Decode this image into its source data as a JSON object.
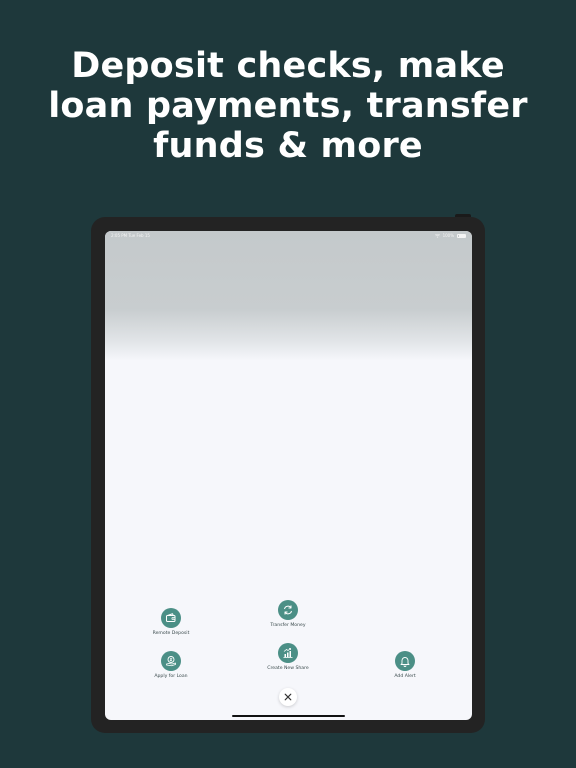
{
  "headline": {
    "line1": "Deposit checks, make",
    "line2": "loan payments, transfer",
    "line3": "funds & more"
  },
  "statusbar": {
    "time": "2:05 PM   Tue Feb 15",
    "battery": "100%"
  },
  "actions": {
    "remote_deposit": "Remote Deposit",
    "transfer_money": "Transfer Money",
    "apply_for_loan": "Apply for Loan",
    "create_new_share": "Create New Share",
    "add_alert": "Add Alert"
  },
  "colors": {
    "background": "#1e383b",
    "accent": "#4b8f86",
    "screen": "#f6f7fb"
  },
  "icons": {
    "remote_deposit": "wallet-icon",
    "transfer_money": "transfer-arrows-icon",
    "apply_for_loan": "loan-hand-coin-icon",
    "create_new_share": "growth-chart-icon",
    "add_alert": "bell-icon",
    "close": "close-icon"
  }
}
